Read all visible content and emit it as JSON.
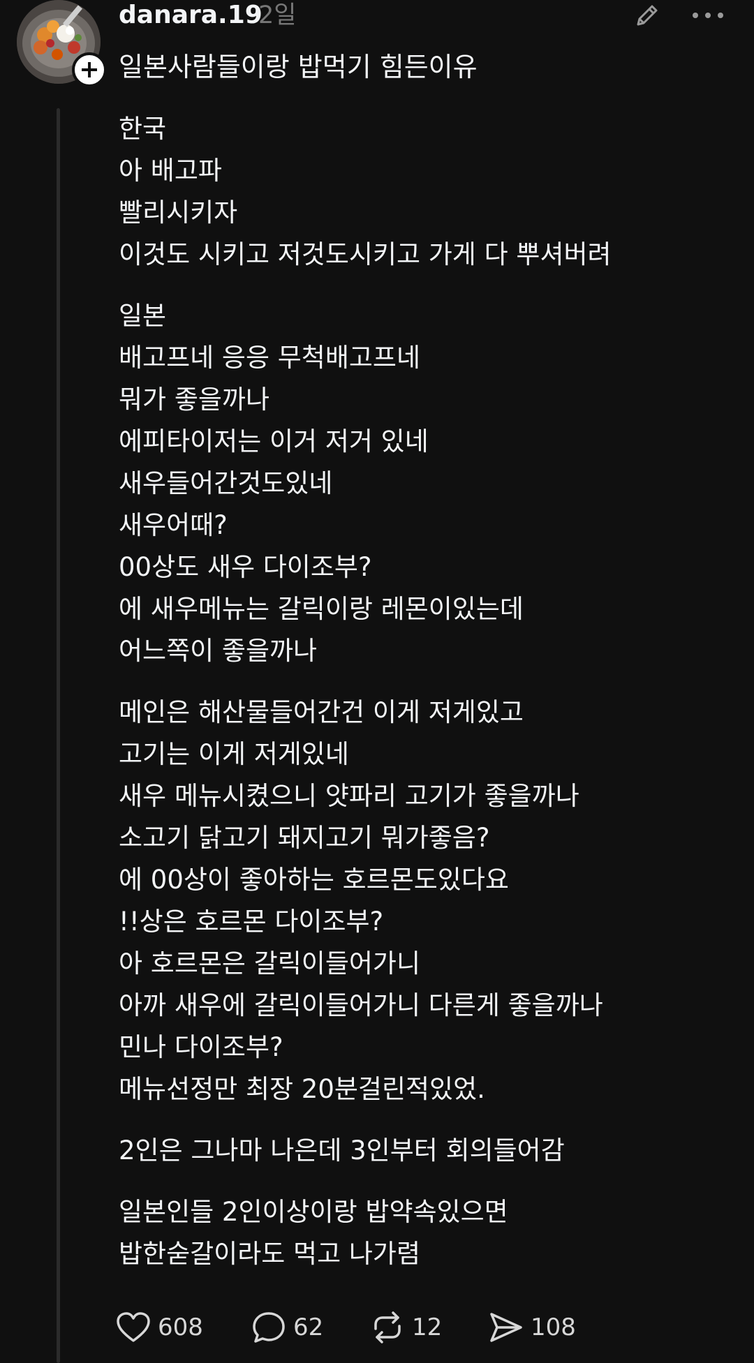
{
  "post": {
    "author": "danara.19",
    "time": "2일",
    "title": "일본사람들이랑 밥먹기 힘든이유",
    "paragraphs": [
      [
        "한국",
        "아 배고파",
        "빨리시키자",
        "이것도 시키고 저것도시키고 가게 다 뿌셔버려"
      ],
      [
        "일본",
        "배고프네 응응 무척배고프네",
        "뭐가 좋을까나",
        "에피타이저는 이거 저거 있네",
        "새우들어간것도있네",
        "새우어때?",
        "00상도 새우 다이조부?",
        "에 새우메뉴는 갈릭이랑 레몬이있는데",
        "어느쪽이 좋을까나"
      ],
      [
        "메인은 해산물들어간건 이게 저게있고",
        "고기는 이게 저게있네",
        "새우 메뉴시켰으니 얏파리 고기가 좋을까나",
        "소고기 닭고기 돼지고기 뭐가좋음?",
        "에 00상이 좋아하는 호르몬도있다요",
        "!!상은 호르몬 다이조부?",
        "아 호르몬은 갈릭이들어가니",
        "아까 새우에 갈릭이들어가니 다른게 좋을까나",
        "민나 다이조부?",
        "메뉴선정만 최장 20분걸린적있었."
      ],
      [
        "2인은 그나마 나은데 3인부터 회의들어감"
      ],
      [
        "일본인들 2인이상이랑 밥약속있으면",
        "밥한숟갈이라도 먹고 나가렴"
      ]
    ]
  },
  "actions": {
    "likes": "608",
    "replies": "62",
    "reposts": "12",
    "shares": "108"
  },
  "icons": {
    "avatar": "food-plate-avatar",
    "follow": "plus-icon",
    "edit": "pencil-icon",
    "more": "more-dots-icon",
    "like": "heart-icon",
    "reply": "comment-icon",
    "repost": "repost-icon",
    "share": "send-icon"
  },
  "colors": {
    "background": "#101010",
    "text": "#f3f5f7",
    "muted": "#777777",
    "thread_line": "#2b2b2b"
  }
}
